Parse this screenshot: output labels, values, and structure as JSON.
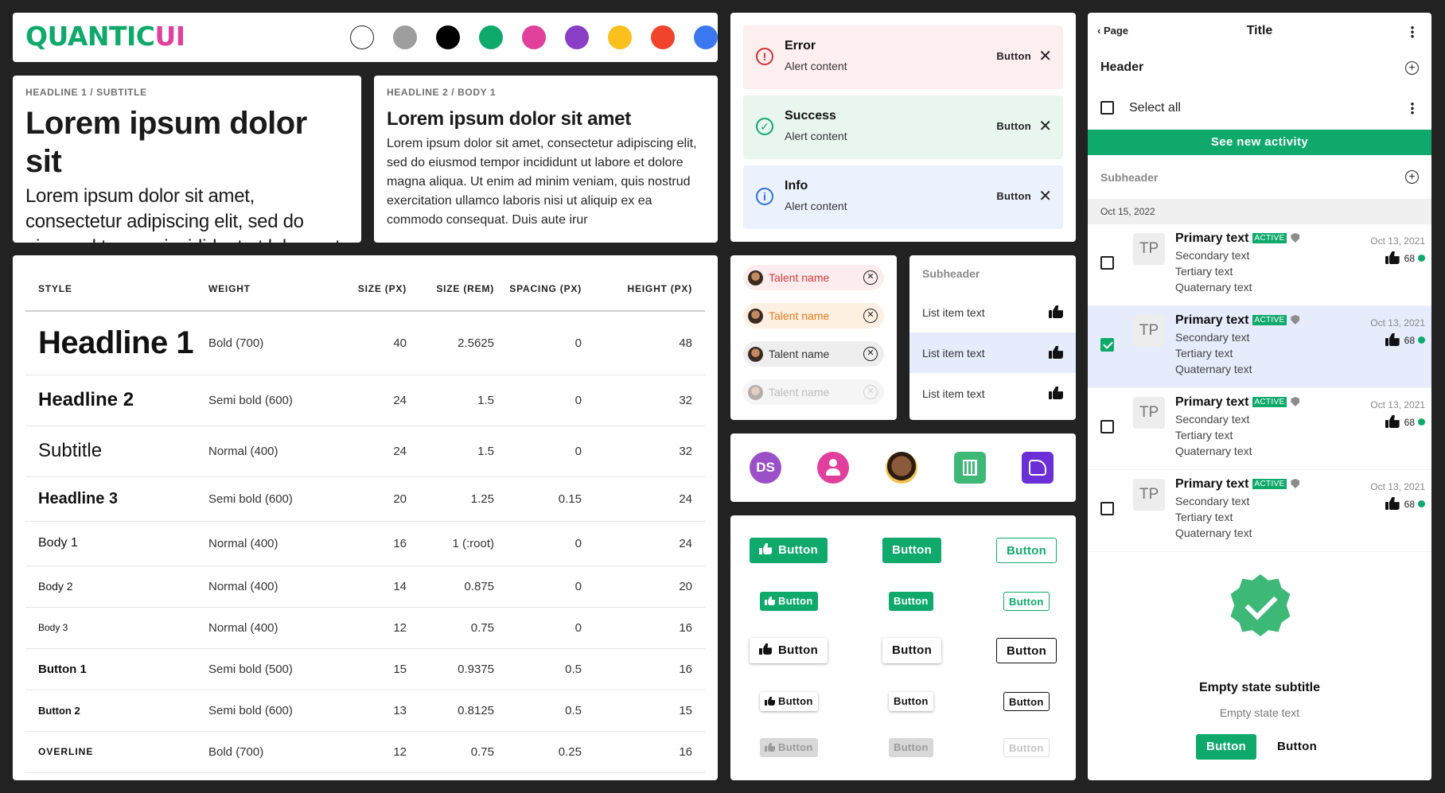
{
  "logo": {
    "main": "QUANTIC",
    "accent": "UI"
  },
  "palette": [
    "#ffffff",
    "#9e9e9e",
    "#000000",
    "#0fa96b",
    "#e0409b",
    "#8a3ec6",
    "#fbbf1e",
    "#f0442c",
    "#3b78f0"
  ],
  "headline1_card": {
    "overline": "HEADLINE 1 / SUBTITLE",
    "title": "Lorem ipsum dolor sit",
    "body": "Lorem ipsum dolor sit amet, consectetur adipiscing elit, sed do eiusmod tempor incididunt ut labore et dolore magna ."
  },
  "headline2_card": {
    "overline": "HEADLINE 2 / BODY 1",
    "title": "Lorem ipsum dolor sit amet",
    "body": "Lorem ipsum dolor sit amet, consectetur adipiscing elit, sed do eiusmod tempor incididunt ut labore et dolore magna aliqua. Ut enim ad minim veniam, quis nostrud exercitation ullamco laboris nisi ut aliquip ex ea commodo consequat. Duis aute irur"
  },
  "type_table": {
    "headers": [
      "STYLE",
      "WEIGHT",
      "SIZE (PX)",
      "SIZE (REM)",
      "SPACING (PX)",
      "HEIGHT (PX)"
    ],
    "rows": [
      {
        "style": "Headline 1",
        "weight": "Bold (700)",
        "size_px": "40",
        "size_rem": "2.5625",
        "spacing": "0",
        "height": "48"
      },
      {
        "style": "Headline 2",
        "weight": "Semi bold (600)",
        "size_px": "24",
        "size_rem": "1.5",
        "spacing": "0",
        "height": "32"
      },
      {
        "style": "Subtitle",
        "weight": "Normal (400)",
        "size_px": "24",
        "size_rem": "1.5",
        "spacing": "0",
        "height": "32"
      },
      {
        "style": "Headline 3",
        "weight": "Semi bold (600)",
        "size_px": "20",
        "size_rem": "1.25",
        "spacing": "0.15",
        "height": "24"
      },
      {
        "style": "Body 1",
        "weight": "Normal (400)",
        "size_px": "16",
        "size_rem": "1 (:root)",
        "spacing": "0",
        "height": "24"
      },
      {
        "style": "Body 2",
        "weight": "Normal (400)",
        "size_px": "14",
        "size_rem": "0.875",
        "spacing": "0",
        "height": "20"
      },
      {
        "style": "Body 3",
        "weight": "Normal (400)",
        "size_px": "12",
        "size_rem": "0.75",
        "spacing": "0",
        "height": "16"
      },
      {
        "style": "Button 1",
        "weight": "Semi bold (500)",
        "size_px": "15",
        "size_rem": "0.9375",
        "spacing": "0.5",
        "height": "16"
      },
      {
        "style": "Button 2",
        "weight": "Semi bold (600)",
        "size_px": "13",
        "size_rem": "0.8125",
        "spacing": "0.5",
        "height": "15"
      },
      {
        "style": "OVERLINE",
        "weight": "Bold (700)",
        "size_px": "12",
        "size_rem": "0.75",
        "spacing": "0.25",
        "height": "16"
      }
    ]
  },
  "alerts": [
    {
      "title": "Error",
      "content": "Alert content",
      "button": "Button",
      "icon": "!"
    },
    {
      "title": "Success",
      "content": "Alert content",
      "button": "Button",
      "icon": "✓"
    },
    {
      "title": "Info",
      "content": "Alert content",
      "button": "Button",
      "icon": "i"
    }
  ],
  "chips": [
    {
      "label": "Talent name"
    },
    {
      "label": "Talent name"
    },
    {
      "label": "Talent name"
    },
    {
      "label": "Talent name"
    }
  ],
  "small_list": {
    "subheader": "Subheader",
    "items": [
      {
        "label": "List item text"
      },
      {
        "label": "List item text"
      },
      {
        "label": "List item text"
      }
    ]
  },
  "avatars": {
    "initials": "DS"
  },
  "buttons": {
    "label": "Button"
  },
  "panel": {
    "back": "Page",
    "title": "Title",
    "header": "Header",
    "select_all": "Select all",
    "activity": "See new activity",
    "subheader": "Subheader",
    "date": "Oct 15, 2022",
    "rows": [
      {
        "avatar": "TP",
        "primary": "Primary text",
        "badge": "ACTIVE",
        "secondary": "Secondary text",
        "tertiary": "Tertiary text",
        "quaternary": "Quaternary text",
        "date": "Oct 13, 2021",
        "count": "68"
      },
      {
        "avatar": "TP",
        "primary": "Primary text",
        "badge": "ACTIVE",
        "secondary": "Secondary text",
        "tertiary": "Tertiary text",
        "quaternary": "Quaternary text",
        "date": "Oct 13, 2021",
        "count": "68"
      },
      {
        "avatar": "TP",
        "primary": "Primary text",
        "badge": "ACTIVE",
        "secondary": "Secondary text",
        "tertiary": "Tertiary text",
        "quaternary": "Quaternary text",
        "date": "Oct 13, 2021",
        "count": "68"
      },
      {
        "avatar": "TP",
        "primary": "Primary text",
        "badge": "ACTIVE",
        "secondary": "Secondary text",
        "tertiary": "Tertiary text",
        "quaternary": "Quaternary text",
        "date": "Oct 13, 2021",
        "count": "68"
      }
    ],
    "empty_state": {
      "subtitle": "Empty state subtitle",
      "text": "Empty state text",
      "primary_button": "Button",
      "secondary_button": "Button"
    }
  }
}
